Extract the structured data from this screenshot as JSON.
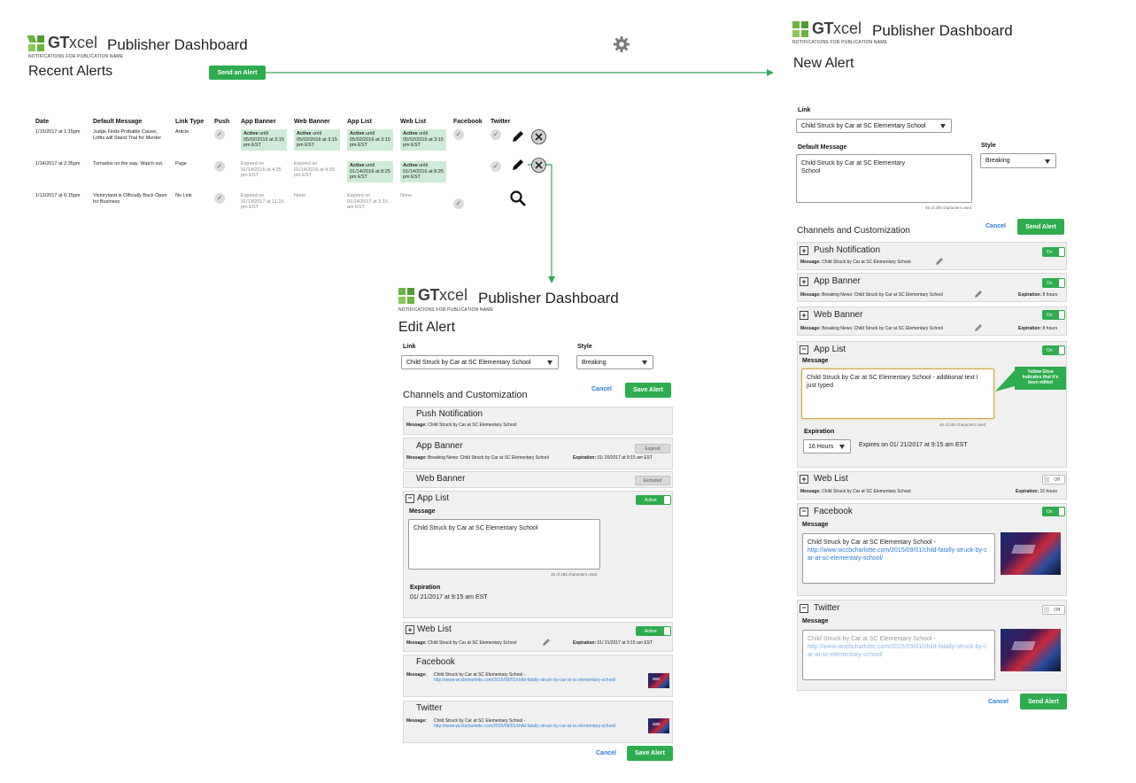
{
  "brand": {
    "gt": "GT",
    "xcel": "xcel",
    "tagline": "NOTIFICATIONS FOR PUBLICATION NAME",
    "app_title": "Publisher Dashboard",
    "color_green": "#6db33f"
  },
  "recent": {
    "heading": "Recent Alerts",
    "send_button": "Send an Alert",
    "columns": [
      "Date",
      "Default Message",
      "Link Type",
      "Push",
      "App Banner",
      "Web Banner",
      "App List",
      "Web List",
      "Facebook",
      "Twitter"
    ],
    "rows": [
      {
        "date": "1/15/2017 at 1:15pm",
        "message": "Judge Finds Probable Cause; Loftis will Stand Trial for Murder",
        "link_type": "Article",
        "app_banner": {
          "state": "Active",
          "text": "until 05/02/2016 at 3:15 pm EST"
        },
        "web_banner": {
          "state": "Active",
          "text": "until 05/02/2016 at 3:15 pm EST"
        },
        "app_list": {
          "state": "Active",
          "text": "until 05/02/2016 at 3:15 pm EST"
        },
        "web_list": {
          "state": "Active",
          "text": "until 05/02/2016 at 3:15 pm EST"
        }
      },
      {
        "date": "1/14/2017 at 2:35pm",
        "message": "Tornados on the way. Watch out.",
        "link_type": "Page",
        "app_banner": {
          "state": "Expired",
          "text": "Expired on 01/14/2016 at 4:25 pm EST"
        },
        "web_banner": {
          "state": "Expired",
          "text": "Expired on 01/14/2016 at 4:25 pm EST"
        },
        "app_list": {
          "state": "Active",
          "text": "until 01/14/2016 at 8:25 pm EST"
        },
        "web_list": {
          "state": "Active",
          "text": "until 01/14/2016 at 8:25 pm EST"
        }
      },
      {
        "date": "1/13/2017 at 6:15pm",
        "message": "Victoryland is Officially Back Open for Business",
        "link_type": "No Link",
        "app_banner": {
          "state": "Expired",
          "text": "Expired on 01/13/2017 at 11:15 pm EST"
        },
        "web_banner": {
          "state": "None",
          "text": "None"
        },
        "app_list": {
          "state": "Expired",
          "text": "Expired on 01/14/2017 at 3:15 am EST"
        },
        "web_list": {
          "state": "None",
          "text": "None"
        }
      }
    ],
    "active_word": "Active"
  },
  "edit": {
    "heading": "Edit Alert",
    "link_label": "Link",
    "link_value": "Child Struck by Car at SC Elementary School",
    "style_label": "Style",
    "style_value": "Breaking",
    "channels_heading": "Channels and Customization",
    "cancel": "Cancel",
    "save": "Save Alert",
    "push": {
      "name": "Push Notification",
      "msg_label": "Message:",
      "msg": "Child Struck by Car at SC Elementary School"
    },
    "app_banner": {
      "name": "App Banner",
      "status": "Expired",
      "msg_label": "Message:",
      "msg": "Breaking News: Child Struck by Car at SC Elementary School",
      "exp_label": "Expiration:",
      "exp": "01/ 20/2017 at 9:15 am EST"
    },
    "web_banner": {
      "name": "Web Banner",
      "status": "Excluded"
    },
    "app_list": {
      "name": "App List",
      "status": "Active",
      "msg_label": "Message",
      "msg": "Child Struck by Car at SC Elementary School",
      "chars": "45 of 255 characters used",
      "exp_label": "Expiration",
      "exp": "01/ 21/2017 at 9:15 am EST"
    },
    "web_list": {
      "name": "Web List",
      "status": "Active",
      "msg_label": "Message:",
      "msg": "Child Struck by Car at SC Elementary School",
      "exp_label": "Expiration:",
      "exp": "01/ 21/2017 at 9:15 am EST"
    },
    "facebook": {
      "name": "Facebook",
      "msg_label": "Message:",
      "msg": "Child Struck by Car at SC Elementary School -",
      "url": "http://www.wccbcharlotte.com/2015/09/01/child-fatally-struck-by-car-at-sc-elementary-school/"
    },
    "twitter": {
      "name": "Twitter",
      "msg_label": "Message:",
      "msg": "Child Struck by Car at SC Elementary School -",
      "url": "http://www.wccbcharlotte.com/2015/09/01/child-fatally-struck-by-car-at-sc-elementary-school/"
    }
  },
  "newalert": {
    "heading": "New Alert",
    "link_label": "Link",
    "link_value": "Child Struck by Car at SC Elementary School",
    "default_label": "Default Message",
    "default_value": "Child Struck by Car at SC Elementary School",
    "chars": "45 of 255 characters used",
    "style_label": "Style",
    "style_value": "Breaking",
    "channels_heading": "Channels and Customization",
    "cancel": "Cancel",
    "send": "Send Alert",
    "on": "On",
    "off": "Off",
    "push": {
      "name": "Push Notification",
      "msg_label": "Message:",
      "msg": "Child Struck by Car at SC Elementary School"
    },
    "app_banner": {
      "name": "App Banner",
      "msg_label": "Message:",
      "msg": "Breaking News: Child Struck by Car at SC Elementary School",
      "exp_label": "Expiration:",
      "exp": "8 hours"
    },
    "web_banner": {
      "name": "Web Banner",
      "msg_label": "Message:",
      "msg": "Breaking News: Child Struck by Car at SC Elementary School",
      "exp_label": "Expiration:",
      "exp": "8 hours"
    },
    "app_list": {
      "name": "App List",
      "msg_label": "Message",
      "msg": "Child Struck by Car at SC Elementary School - additional text I just typed",
      "chars": "45 of 255 characters used",
      "exp_label": "Expiration",
      "exp_select": "16 Hours",
      "exp_text": "Expires on 01/ 21/2017 at 9:15 am EST",
      "tooltip": "Yellow Glow Indicates that it's been edited"
    },
    "web_list": {
      "name": "Web List",
      "msg_label": "Message:",
      "msg": "Child Struck by Car at SC Elementary School",
      "exp_label": "Expiration:",
      "exp": "16 hours"
    },
    "facebook": {
      "name": "Facebook",
      "msg_label": "Message",
      "msg": "Child Struck by Car at SC Elementary School -",
      "url": "http://www.wccbcharlotte.com/2015/09/01/child-fatally-struck-by-car-at-sc-elementary-school/"
    },
    "twitter": {
      "name": "Twitter",
      "msg_label": "Message",
      "msg": "Child Struck by Car at SC Elementary School -",
      "url": "http://www.wccbcharlotte.com/2015/09/01/child-fatally-struck-by-car-at-sc-elementary-school/"
    }
  }
}
